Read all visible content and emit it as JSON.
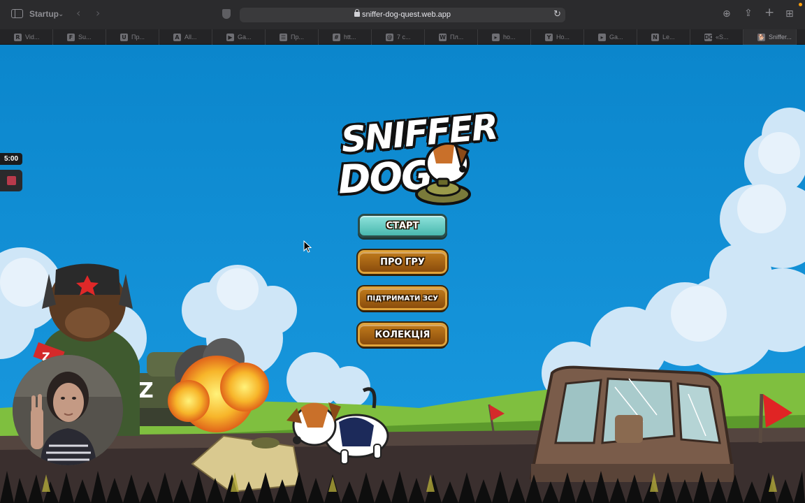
{
  "browser": {
    "tab_group": "Startup",
    "url": "sniffer-dog-quest.web.app",
    "tabs": [
      {
        "favicon": "R",
        "title": "Vid..."
      },
      {
        "favicon": "F",
        "title": "Su..."
      },
      {
        "favicon": "U",
        "title": "Пр..."
      },
      {
        "favicon": "A",
        "title": "All..."
      },
      {
        "favicon": "▶",
        "title": "Ga..."
      },
      {
        "favicon": "☰",
        "title": "Пр..."
      },
      {
        "favicon": "#",
        "title": "htt..."
      },
      {
        "favicon": "@",
        "title": "7 с..."
      },
      {
        "favicon": "W",
        "title": "Пл..."
      },
      {
        "favicon": "▸",
        "title": "ho..."
      },
      {
        "favicon": "Y",
        "title": "Ho..."
      },
      {
        "favicon": "▸",
        "title": "Ga..."
      },
      {
        "favicon": "N",
        "title": "Le..."
      },
      {
        "favicon": "DOU",
        "title": "«S..."
      },
      {
        "favicon": "🐕",
        "title": "Sniffer..."
      }
    ],
    "icons": [
      "sidebar-icon",
      "chevron-down-icon",
      "back-icon",
      "forward-icon",
      "shield-icon",
      "lock-icon",
      "reload-icon",
      "download-icon",
      "share-icon",
      "plus-icon",
      "tab-overview-icon"
    ]
  },
  "game": {
    "logo": {
      "line1": "SNIFFER",
      "line2": "DOG"
    },
    "menu": {
      "start": "СТАРТ",
      "about": "ПРО ГРУ",
      "support": "ПІДТРИМАТИ ЗСУ",
      "collection": "КОЛЕКЦІЯ"
    },
    "colors": {
      "sky": "#0e8cd0",
      "grass": "#6fae3a",
      "road": "#3b2f2f",
      "start_button": "#5ec5bb",
      "menu_button": "#a8631a"
    }
  },
  "recording": {
    "timer": "5:00"
  }
}
